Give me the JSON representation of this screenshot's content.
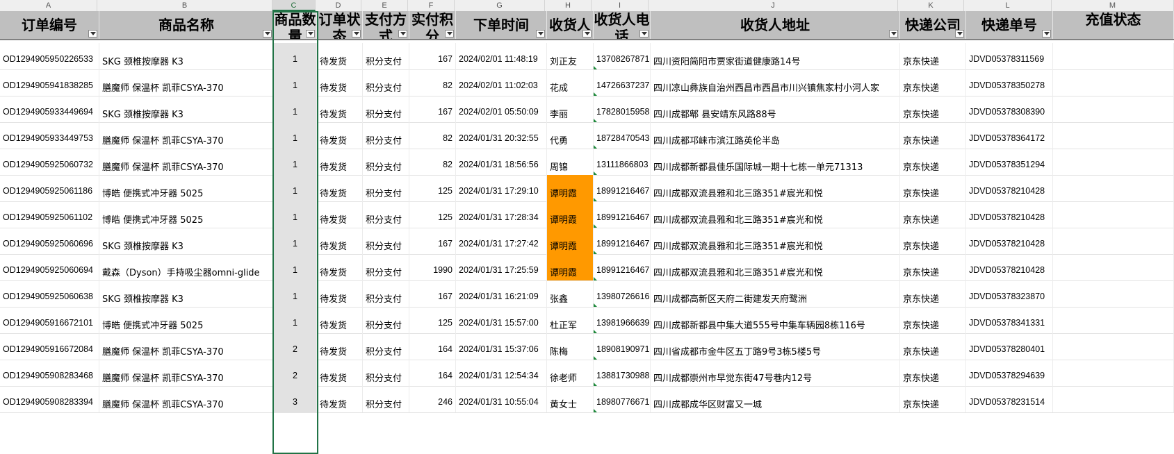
{
  "columns": [
    "A",
    "B",
    "C",
    "D",
    "E",
    "F",
    "G",
    "H",
    "I",
    "J",
    "K",
    "L",
    "M"
  ],
  "selected_column": "C",
  "headers": [
    "订单编号",
    "商品名称",
    "商品数量",
    "订单状态",
    "支付方式",
    "实付积分",
    "下单时间",
    "收货人",
    "收货人电话",
    "收货人地址",
    "快递公司",
    "快递单号",
    "充值状态"
  ],
  "highlight_color": "#ff9900",
  "rows": [
    [
      "OD1294905950226533",
      "SKG 颈椎按摩器 K3",
      "1",
      "待发货",
      "积分支付",
      "167",
      "2024/02/01 11:48:19",
      "刘正友",
      "13708267871",
      "四川资阳简阳市贾家街道健康路14号",
      "京东快递",
      "JDVD05378311569",
      ""
    ],
    [
      "OD1294905941838285",
      "膳魔师 保温杯 凯菲CSYA-370",
      "1",
      "待发货",
      "积分支付",
      "82",
      "2024/02/01 11:02:03",
      "花成",
      "14726637237",
      "四川凉山彝族自治州西昌市西昌市川兴镇焦家村小河人家",
      "京东快递",
      "JDVD05378350278",
      ""
    ],
    [
      "OD1294905933449694",
      "SKG 颈椎按摩器 K3",
      "1",
      "待发货",
      "积分支付",
      "167",
      "2024/02/01 05:50:09",
      "李丽",
      "17828015958",
      "四川成都郫 县安靖东风路88号",
      "京东快递",
      "JDVD05378308390",
      ""
    ],
    [
      "OD1294905933449753",
      "膳魔师 保温杯 凯菲CSYA-370",
      "1",
      "待发货",
      "积分支付",
      "82",
      "2024/01/31 20:32:55",
      "代勇",
      "18728470543",
      "四川成都邛崃市滨江路英伦半岛",
      "京东快递",
      "JDVD05378364172",
      ""
    ],
    [
      "OD1294905925060732",
      "膳魔师 保温杯 凯菲CSYA-370",
      "1",
      "待发货",
      "积分支付",
      "82",
      "2024/01/31 18:56:56",
      "周锦",
      "13111866803",
      "四川成都新都县佳乐国际城一期十七栋一单元71313",
      "京东快递",
      "JDVD05378351294",
      ""
    ],
    [
      "OD1294905925061186",
      "博皓 便携式冲牙器 5025",
      "1",
      "待发货",
      "积分支付",
      "125",
      "2024/01/31 17:29:10",
      "谭明霞",
      "18991216467",
      "四川成都双流县雅和北三路351#宸光和悦",
      "京东快递",
      "JDVD05378210428",
      ""
    ],
    [
      "OD1294905925061102",
      "博皓 便携式冲牙器 5025",
      "1",
      "待发货",
      "积分支付",
      "125",
      "2024/01/31 17:28:34",
      "谭明霞",
      "18991216467",
      "四川成都双流县雅和北三路351#宸光和悦",
      "京东快递",
      "JDVD05378210428",
      ""
    ],
    [
      "OD1294905925060696",
      "SKG 颈椎按摩器 K3",
      "1",
      "待发货",
      "积分支付",
      "167",
      "2024/01/31 17:27:42",
      "谭明霞",
      "18991216467",
      "四川成都双流县雅和北三路351#宸光和悦",
      "京东快递",
      "JDVD05378210428",
      ""
    ],
    [
      "OD1294905925060694",
      "戴森（Dyson）手持吸尘器omni-glide",
      "1",
      "待发货",
      "积分支付",
      "1990",
      "2024/01/31 17:25:59",
      "谭明霞",
      "18991216467",
      "四川成都双流县雅和北三路351#宸光和悦",
      "京东快递",
      "JDVD05378210428",
      ""
    ],
    [
      "OD1294905925060638",
      "SKG 颈椎按摩器 K3",
      "1",
      "待发货",
      "积分支付",
      "167",
      "2024/01/31 16:21:09",
      "张鑫",
      "13980726616",
      "四川成都高新区天府二街建发天府鹭洲",
      "京东快递",
      "JDVD05378323870",
      ""
    ],
    [
      "OD1294905916672101",
      "博皓 便携式冲牙器 5025",
      "1",
      "待发货",
      "积分支付",
      "125",
      "2024/01/31 15:57:00",
      "杜正军",
      "13981966639",
      "四川成都新都县中集大道555号中集车辆园8栋116号",
      "京东快递",
      "JDVD05378341331",
      ""
    ],
    [
      "OD1294905916672084",
      "膳魔师 保温杯 凯菲CSYA-370",
      "2",
      "待发货",
      "积分支付",
      "164",
      "2024/01/31 15:37:06",
      "陈梅",
      "18908190971",
      "四川省成都市金牛区五丁路9号3栋5楼5号",
      "京东快递",
      "JDVD05378280401",
      ""
    ],
    [
      "OD1294905908283468",
      "膳魔师 保温杯 凯菲CSYA-370",
      "2",
      "待发货",
      "积分支付",
      "164",
      "2024/01/31 12:54:34",
      "徐老师",
      "13881730988",
      "四川成都崇州市早觉东街47号巷内12号",
      "京东快递",
      "JDVD05378294639",
      ""
    ],
    [
      "OD1294905908283394",
      "膳魔师 保温杯 凯菲CSYA-370",
      "3",
      "待发货",
      "积分支付",
      "246",
      "2024/01/31 10:55:04",
      "黄女士",
      "18980776671",
      "四川成都成华区财富又一城",
      "京东快递",
      "JDVD05378231514",
      ""
    ]
  ],
  "highlighted_rows": [
    5,
    6,
    7,
    8
  ]
}
